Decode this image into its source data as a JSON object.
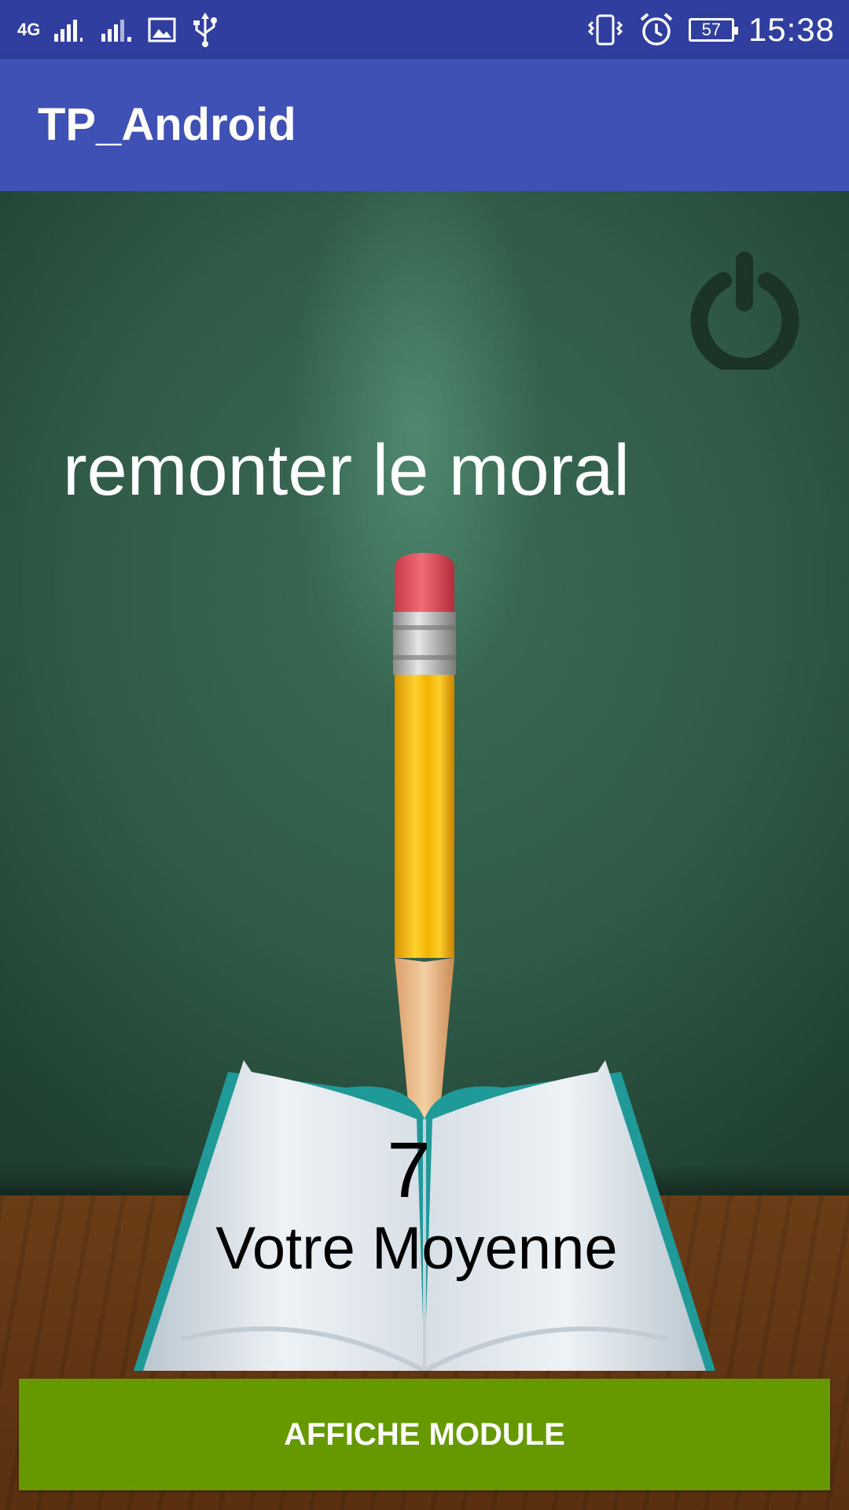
{
  "status_bar": {
    "network_label": "4G",
    "battery_level": "57",
    "time": "15:38",
    "icons": [
      "signal-sim1-icon",
      "signal-sim2-icon",
      "image-notification-icon",
      "usb-icon",
      "vibrate-icon",
      "alarm-icon",
      "battery-icon"
    ]
  },
  "app_bar": {
    "title": "TP_Android"
  },
  "main": {
    "headline": "remonter le moral",
    "grade_value": "7",
    "grade_label": "Votre Moyenne",
    "power_icon": "power-icon"
  },
  "action": {
    "button_label": "AFFICHE MODULE"
  },
  "colors": {
    "status_bar": "#303f9f",
    "app_bar": "#3f51b5",
    "chalkboard": "#2f5947",
    "button": "#669900",
    "desk": "#6b3d17"
  }
}
